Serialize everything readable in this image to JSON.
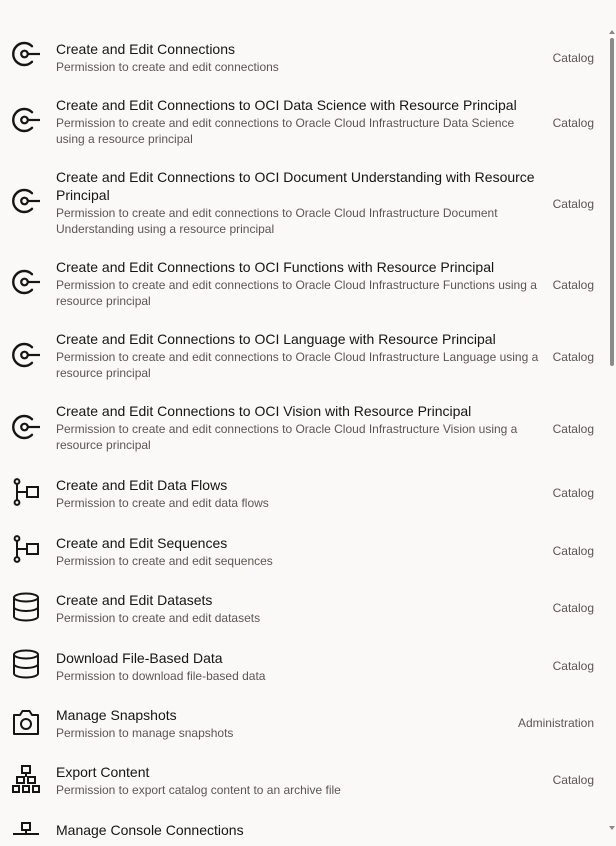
{
  "permissions": [
    {
      "title": "Create and Edit Connections",
      "description": "Permission to create and edit connections",
      "category": "Catalog",
      "icon": "connection-icon"
    },
    {
      "title": "Create and Edit Connections to OCI Data Science with Resource Principal",
      "description": "Permission to create and edit connections to Oracle Cloud Infrastructure Data Science using a resource principal",
      "category": "Catalog",
      "icon": "connection-icon"
    },
    {
      "title": "Create and Edit Connections to OCI Document Understanding with Resource Principal",
      "description": "Permission to create and edit connections to Oracle Cloud Infrastructure Document Understanding using a resource principal",
      "category": "Catalog",
      "icon": "connection-icon"
    },
    {
      "title": "Create and Edit Connections to OCI Functions with Resource Principal",
      "description": "Permission to create and edit connections to Oracle Cloud Infrastructure Functions using a resource principal",
      "category": "Catalog",
      "icon": "connection-icon"
    },
    {
      "title": "Create and Edit Connections to OCI Language with Resource Principal",
      "description": "Permission to create and edit connections to Oracle Cloud Infrastructure Language using a resource principal",
      "category": "Catalog",
      "icon": "connection-icon"
    },
    {
      "title": "Create and Edit Connections to OCI Vision with Resource Principal",
      "description": "Permission to create and edit connections to Oracle Cloud Infrastructure Vision using a resource principal",
      "category": "Catalog",
      "icon": "connection-icon"
    },
    {
      "title": "Create and Edit Data Flows",
      "description": "Permission to create and edit data flows",
      "category": "Catalog",
      "icon": "data-flow-icon"
    },
    {
      "title": "Create and Edit Sequences",
      "description": "Permission to create and edit sequences",
      "category": "Catalog",
      "icon": "data-flow-icon"
    },
    {
      "title": "Create and Edit Datasets",
      "description": "Permission to create and edit datasets",
      "category": "Catalog",
      "icon": "database-icon"
    },
    {
      "title": "Download File-Based Data",
      "description": "Permission to download file-based data",
      "category": "Catalog",
      "icon": "database-icon"
    },
    {
      "title": "Manage Snapshots",
      "description": "Permission to manage snapshots",
      "category": "Administration",
      "icon": "camera-icon"
    },
    {
      "title": "Export Content",
      "description": "Permission to export catalog content to an archive file",
      "category": "Catalog",
      "icon": "hierarchy-icon"
    },
    {
      "title": "Manage Console Connections",
      "description": "",
      "category": "",
      "icon": "console-icon"
    }
  ]
}
